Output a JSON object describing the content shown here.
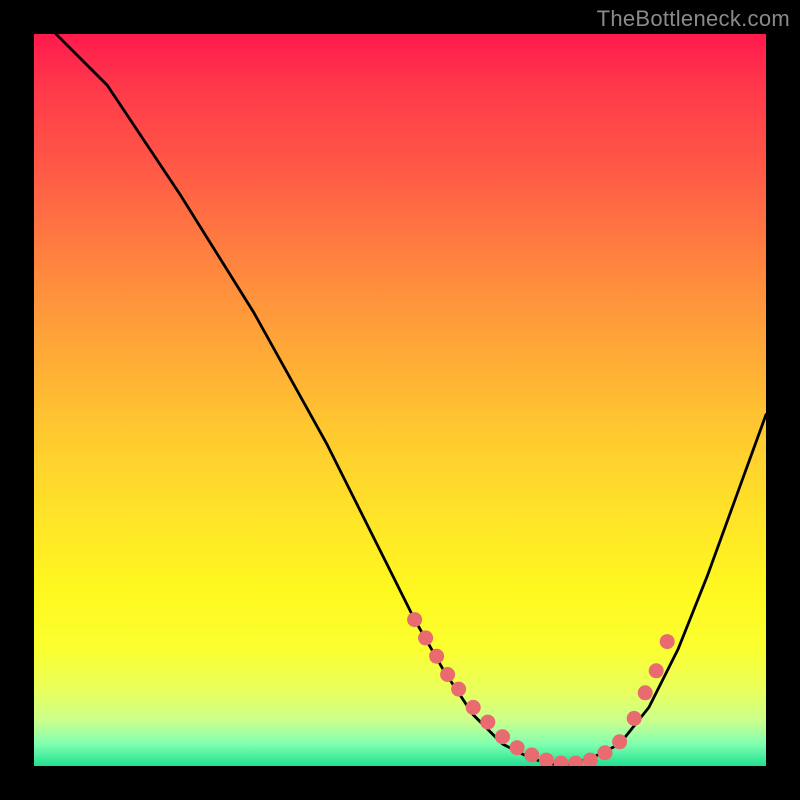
{
  "watermark": "TheBottleneck.com",
  "chart_data": {
    "type": "line",
    "title": "",
    "xlabel": "",
    "ylabel": "",
    "xlim": [
      0,
      100
    ],
    "ylim": [
      0,
      100
    ],
    "series": [
      {
        "name": "curve",
        "x": [
          3,
          10,
          20,
          30,
          40,
          48,
          52,
          56,
          60,
          64,
          68,
          72,
          76,
          80,
          84,
          88,
          92,
          96,
          100
        ],
        "y": [
          100,
          93,
          78,
          62,
          44,
          28,
          20,
          13,
          7,
          3,
          1,
          0,
          1,
          3,
          8,
          16,
          26,
          37,
          48
        ]
      }
    ],
    "markers": {
      "name": "highlight-points",
      "x": [
        52,
        53.5,
        55,
        56.5,
        58,
        60,
        62,
        64,
        66,
        68,
        70,
        72,
        74,
        76,
        78,
        80,
        82,
        83.5,
        85,
        86.5
      ],
      "y": [
        20,
        17.5,
        15,
        12.5,
        10.5,
        8,
        6,
        4,
        2.5,
        1.5,
        0.8,
        0.4,
        0.4,
        0.8,
        1.8,
        3.3,
        6.5,
        10,
        13,
        17
      ]
    }
  }
}
